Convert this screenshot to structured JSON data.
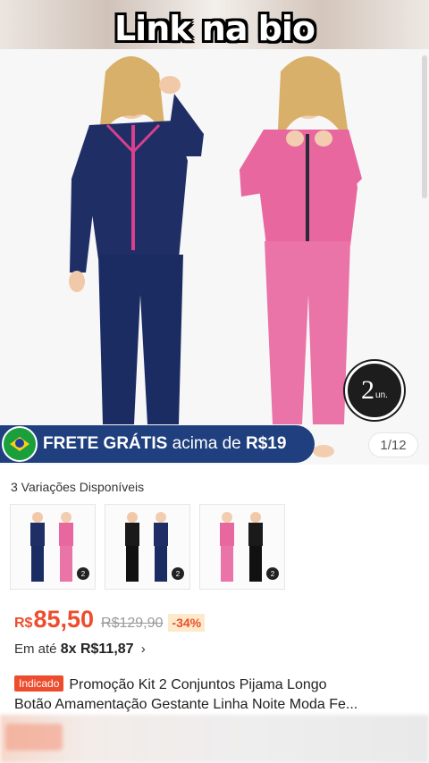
{
  "overlay": {
    "title": "Link na bio"
  },
  "hero": {
    "units_badge": {
      "number": "2",
      "unit": "un."
    },
    "frete_banner": {
      "part1": "FRETE GRÁTIS",
      "part2": "acima de",
      "part3": "R$19",
      "flag_icon": "brazil-flag-icon"
    },
    "pager": "1/12",
    "colors": {
      "navy": "#1f3f7f",
      "pink": "#e8679f"
    }
  },
  "variations": {
    "label": "3 Variações Disponíveis",
    "thumbs": [
      {
        "badge": "2"
      },
      {
        "badge": "2"
      },
      {
        "badge": "2"
      }
    ]
  },
  "price": {
    "currency": "R$",
    "value": "85,50",
    "old": "R$129,90",
    "discount": "-34%",
    "accent": "#ee4d2d"
  },
  "installments": {
    "prefix": "Em até",
    "plan": "8x R$11,87",
    "chevron": "›"
  },
  "product": {
    "tag": "Indicado",
    "title_line1": "Promoção Kit 2 Conjuntos Pijama Longo",
    "title_line2": "Botão Amamentação Gestante Linha Noite Moda Fe..."
  }
}
